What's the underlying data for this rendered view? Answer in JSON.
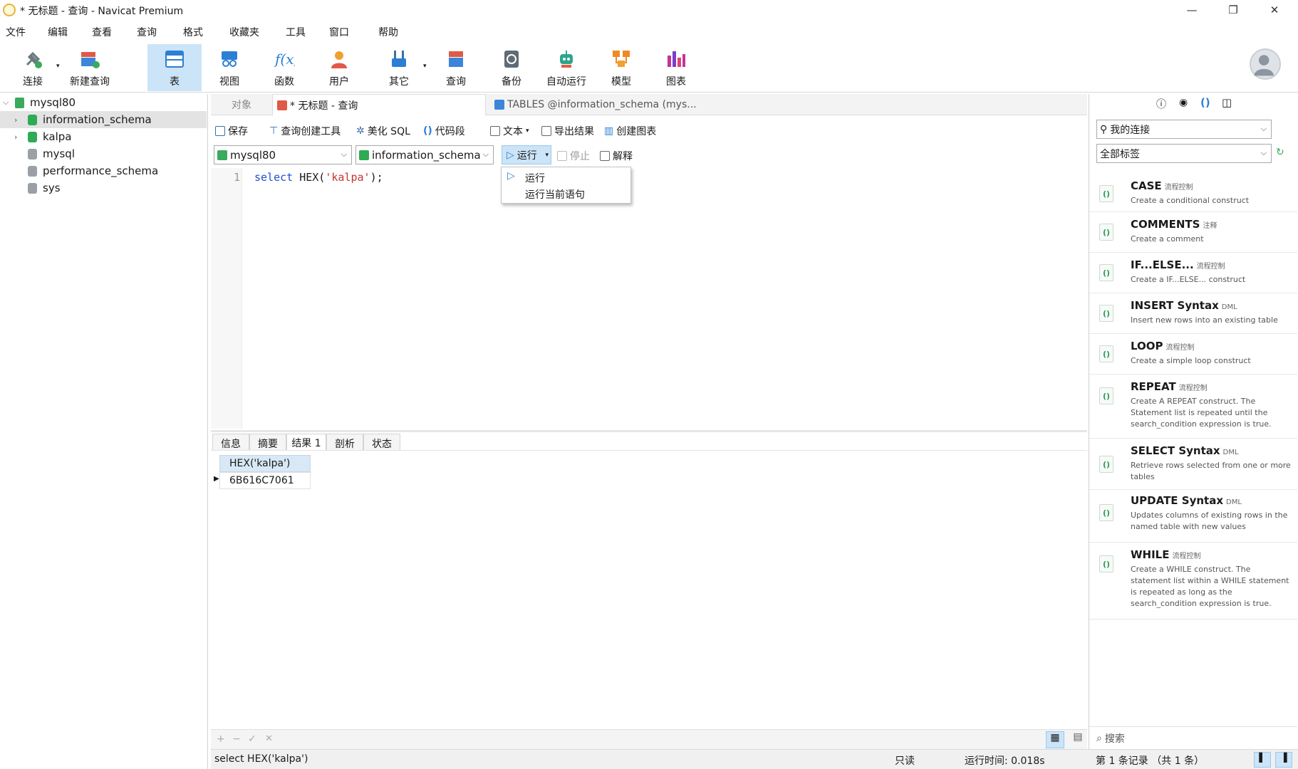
{
  "window": {
    "title": "* 无标题 - 查询 - Navicat Premium",
    "minimize": "—",
    "restore": "❐",
    "close": "✕"
  },
  "menu": [
    "文件",
    "编辑",
    "查看",
    "查询",
    "格式",
    "收藏夹",
    "工具",
    "窗口",
    "帮助"
  ],
  "toolbar": [
    {
      "label": "连接",
      "icon": "plug-icon",
      "color": "#4a9a6a"
    },
    {
      "label": "新建查询",
      "icon": "new-query-icon",
      "color": "#e05a47"
    },
    {
      "label": "表",
      "icon": "table-icon",
      "color": "#2b7fd4"
    },
    {
      "label": "视图",
      "icon": "view-icon",
      "color": "#2b7fd4"
    },
    {
      "label": "函数",
      "icon": "function-icon",
      "color": "#2b7fd4"
    },
    {
      "label": "用户",
      "icon": "user-icon",
      "color": "#f0a030"
    },
    {
      "label": "其它",
      "icon": "tools-icon",
      "color": "#2b7fd4"
    },
    {
      "label": "查询",
      "icon": "query-icon",
      "color": "#e05a47"
    },
    {
      "label": "备份",
      "icon": "backup-icon",
      "color": "#606b75"
    },
    {
      "label": "自动运行",
      "icon": "robot-icon",
      "color": "#2da58e"
    },
    {
      "label": "模型",
      "icon": "model-icon",
      "color": "#f08a24"
    },
    {
      "label": "图表",
      "icon": "chart-icon",
      "color": "#c0359b"
    }
  ],
  "sidebar": {
    "connection": "mysql80",
    "databases": [
      {
        "name": "information_schema",
        "open": true,
        "selected": true
      },
      {
        "name": "kalpa",
        "open": true,
        "selected": false
      },
      {
        "name": "mysql",
        "open": false,
        "selected": false
      },
      {
        "name": "performance_schema",
        "open": false,
        "selected": false
      },
      {
        "name": "sys",
        "open": false,
        "selected": false
      }
    ]
  },
  "tabs": {
    "objects": "对象",
    "query": "* 无标题 - 查询",
    "tables": "TABLES @information_schema (mys..."
  },
  "query_toolbar": {
    "save": "保存",
    "builder": "查询创建工具",
    "beautify": "美化 SQL",
    "snippet": "代码段",
    "text": "文本",
    "export": "导出结果",
    "create_chart": "创建图表"
  },
  "selectors": {
    "connection": "mysql80",
    "database": "information_schema",
    "run": "运行",
    "stop": "停止",
    "explain": "解释"
  },
  "editor": {
    "line": "1",
    "keyword": "select",
    "fn": "HEX(",
    "str": "'kalpa'",
    "tail": ");"
  },
  "run_menu": [
    "运行",
    "运行当前语句"
  ],
  "result_tabs": [
    "信息",
    "摘要",
    "结果 1",
    "剖析",
    "状态"
  ],
  "result": {
    "column": "HEX('kalpa')",
    "value": "6B616C7061"
  },
  "grid_footer": [
    "+",
    "−",
    "✓",
    "✕"
  ],
  "status": {
    "sql": "select HEX('kalpa')",
    "readonly": "只读",
    "runtime": "运行时间: 0.018s",
    "records": "第 1 条记录 （共 1 条）"
  },
  "right": {
    "connection_select": "我的连接",
    "tag_select": "全部标签",
    "search": "搜索",
    "snippets": [
      {
        "title": "CASE",
        "tag": "流程控制",
        "desc": "Create a conditional construct"
      },
      {
        "title": "COMMENTS",
        "tag": "注释",
        "desc": "Create a comment"
      },
      {
        "title": "IF...ELSE...",
        "tag": "流程控制",
        "desc": "Create a IF...ELSE... construct"
      },
      {
        "title": "INSERT Syntax",
        "tag": "DML",
        "desc": "Insert new rows into an existing table"
      },
      {
        "title": "LOOP",
        "tag": "流程控制",
        "desc": "Create a simple loop construct"
      },
      {
        "title": "REPEAT",
        "tag": "流程控制",
        "desc": "Create A REPEAT construct. The Statement list is repeated until the search_condition expression is true."
      },
      {
        "title": "SELECT Syntax",
        "tag": "DML",
        "desc": "Retrieve rows selected from one or more tables"
      },
      {
        "title": "UPDATE Syntax",
        "tag": "DML",
        "desc": "Updates columns of existing rows in the named table with new values"
      },
      {
        "title": "WHILE",
        "tag": "流程控制",
        "desc": "Create a WHILE construct. The statement list within a WHILE statement is repeated as long as the search_condition expression is true."
      }
    ]
  }
}
